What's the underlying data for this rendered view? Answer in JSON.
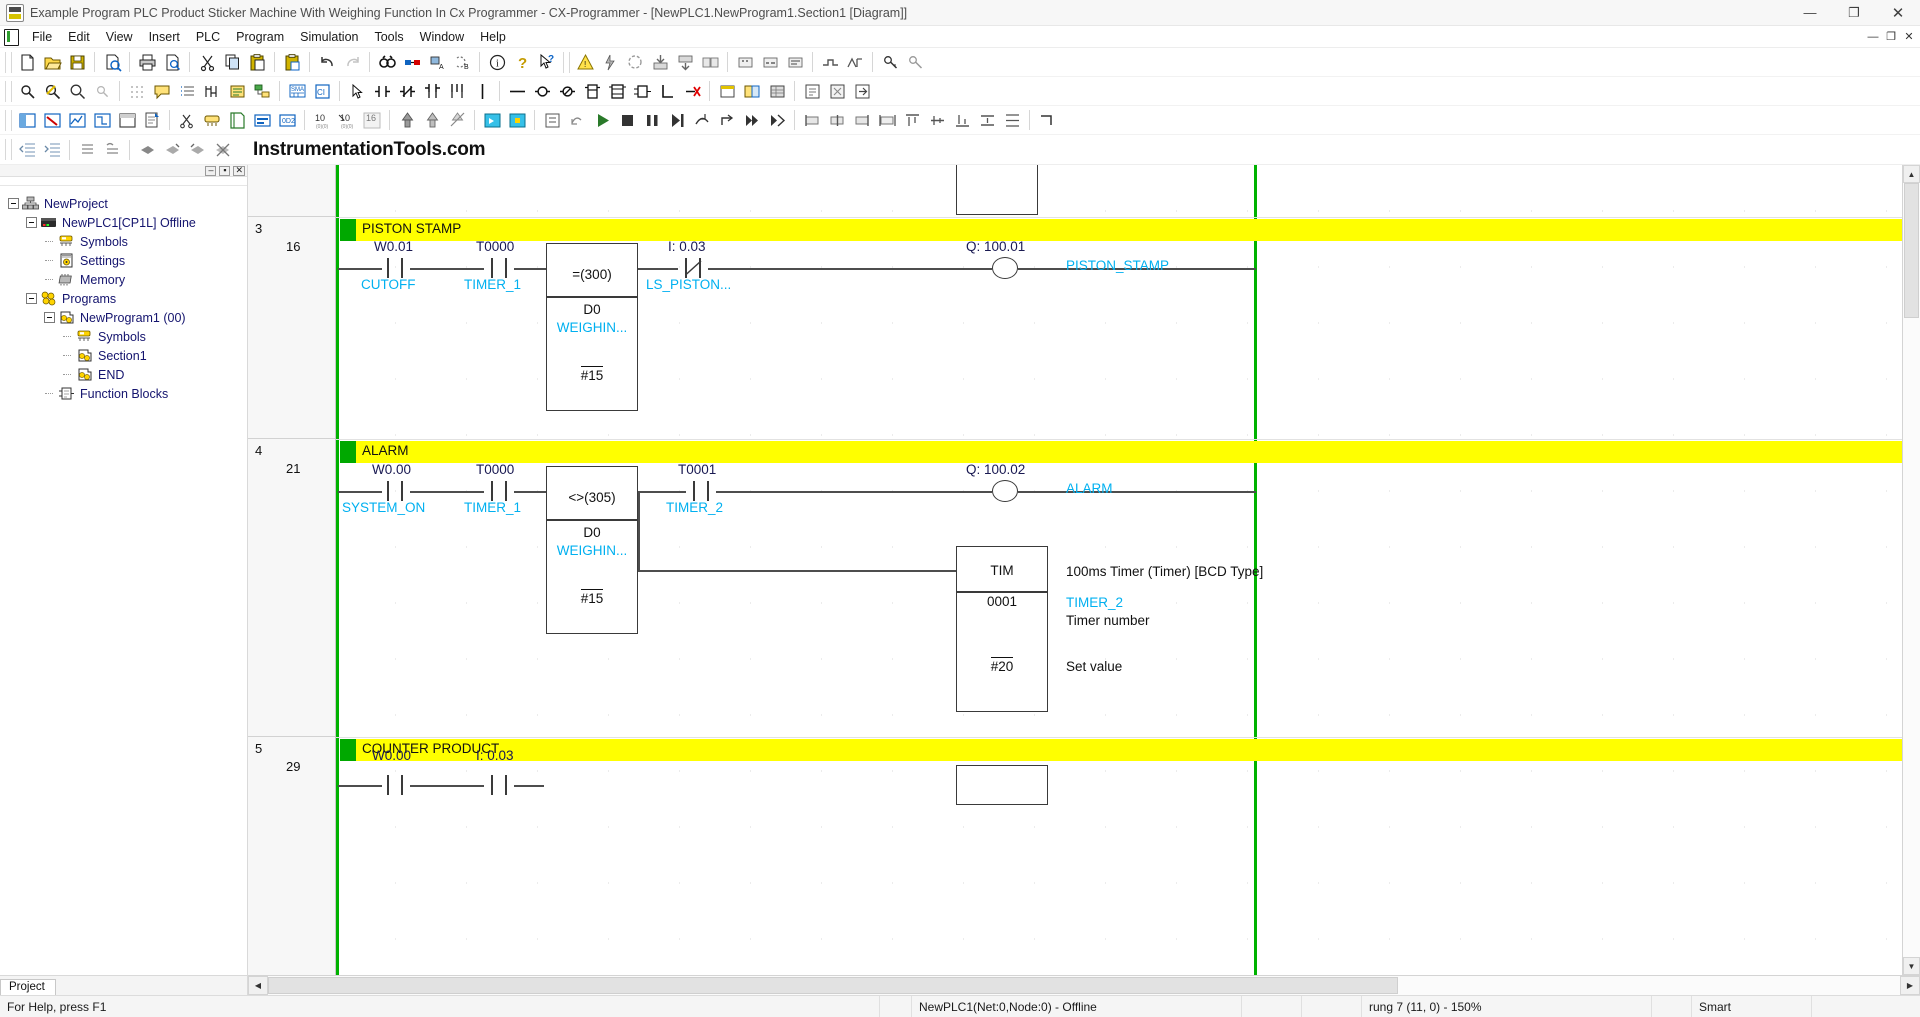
{
  "window": {
    "title": "Example Program PLC Product Sticker Machine With Weighing Function In Cx Programmer - CX-Programmer - [NewPLC1.NewProgram1.Section1 [Diagram]]",
    "app_icon": "plc-app-icon",
    "minimize": "—",
    "maximize": "❐",
    "close": "✕"
  },
  "menu": {
    "icon": "document-icon",
    "items": [
      {
        "label": "File"
      },
      {
        "label": "Edit"
      },
      {
        "label": "View"
      },
      {
        "label": "Insert"
      },
      {
        "label": "PLC"
      },
      {
        "label": "Program"
      },
      {
        "label": "Simulation"
      },
      {
        "label": "Tools"
      },
      {
        "label": "Window"
      },
      {
        "label": "Help"
      }
    ],
    "mdi_minimize": "—",
    "mdi_restore": "❐",
    "mdi_close": "✕"
  },
  "brand": {
    "text": "InstrumentationTools.com"
  },
  "sidebar": {
    "caption_buttons": [
      "–",
      "▪",
      "✕"
    ],
    "tree": [
      {
        "label": "NewProject",
        "indent": 0,
        "expander": "minus",
        "icon": "project-icon"
      },
      {
        "label": "NewPLC1[CP1L] Offline",
        "indent": 1,
        "expander": "minus",
        "icon": "plc-icon"
      },
      {
        "label": "Symbols",
        "indent": 2,
        "expander": "none",
        "icon": "symbols-icon"
      },
      {
        "label": "Settings",
        "indent": 2,
        "expander": "none",
        "icon": "settings-icon"
      },
      {
        "label": "Memory",
        "indent": 2,
        "expander": "none",
        "icon": "memory-icon"
      },
      {
        "label": "Programs",
        "indent": 2,
        "expander": "minus",
        "icon": "programs-icon"
      },
      {
        "label": "NewProgram1 (00)",
        "indent": 3,
        "expander": "minus",
        "icon": "program-icon"
      },
      {
        "label": "Symbols",
        "indent": 4,
        "expander": "none",
        "icon": "symbols-icon"
      },
      {
        "label": "Section1",
        "indent": 4,
        "expander": "none",
        "icon": "section-icon"
      },
      {
        "label": "END",
        "indent": 4,
        "expander": "none",
        "icon": "end-icon"
      },
      {
        "label": "Function Blocks",
        "indent": 2,
        "expander": "none",
        "icon": "function-block-icon"
      }
    ],
    "tab": "Project"
  },
  "ladder": {
    "rungs": [
      {
        "number": "3",
        "step": "16",
        "comment": "PISTON STAMP",
        "contacts": [
          {
            "addr": "W0.01",
            "sym": "CUTOFF",
            "type": "no"
          },
          {
            "addr": "T0000",
            "sym": "TIMER_1",
            "type": "no"
          },
          {
            "addr": "I: 0.03",
            "sym": "LS_PISTON...",
            "type": "nc"
          }
        ],
        "function_block": {
          "instruction": "=(300)",
          "operand": "D0",
          "operand_symbol": "WEIGHIN...",
          "value": "#15"
        },
        "coil": {
          "addr": "Q: 100.01",
          "sym": "PISTON_STAMP"
        }
      },
      {
        "number": "4",
        "step": "21",
        "comment": "ALARM",
        "contacts": [
          {
            "addr": "W0.00",
            "sym": "SYSTEM_ON",
            "type": "no"
          },
          {
            "addr": "T0000",
            "sym": "TIMER_1",
            "type": "no"
          },
          {
            "addr": "T0001",
            "sym": "TIMER_2",
            "type": "no"
          }
        ],
        "function_block": {
          "instruction": "<>(305)",
          "operand": "D0",
          "operand_symbol": "WEIGHIN...",
          "value": "#15"
        },
        "coil": {
          "addr": "Q: 100.02",
          "sym": "ALARM"
        },
        "timer_block": {
          "instruction": "TIM",
          "desc": "100ms Timer (Timer) [BCD Type]",
          "number": "0001",
          "number_sym": "TIMER_2",
          "number_desc": "Timer number",
          "set_value": "#20",
          "set_value_desc": "Set value"
        }
      },
      {
        "number": "5",
        "step": "29",
        "comment": "COUNTER PRODUCT",
        "contacts": [
          {
            "addr": "W0.00",
            "sym": "",
            "type": "no"
          },
          {
            "addr": "I: 0.03",
            "sym": "",
            "type": "no"
          }
        ]
      }
    ]
  },
  "status": {
    "help": "For Help, press F1",
    "plc": "NewPLC1(Net:0,Node:0) - Offline",
    "rung": "rung 7 (11, 0)  -  150%",
    "mode": "Smart"
  },
  "colors": {
    "rung_comment_bg": "#ffff00",
    "rung_mark": "#00a800",
    "rail": "#00b200",
    "symbol_text": "#00b0f0",
    "address_text": "#1a1a52",
    "tree_text": "#14146e"
  }
}
